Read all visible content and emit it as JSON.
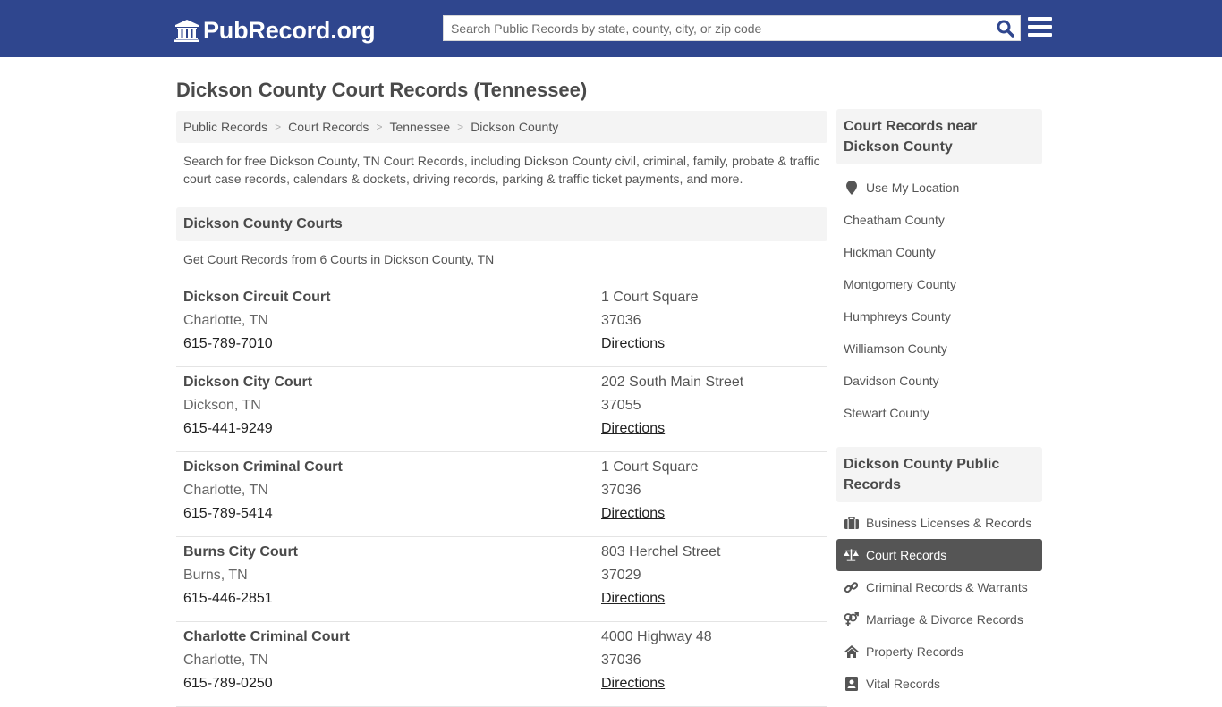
{
  "header": {
    "logo_text": "PubRecord.org",
    "logo_icon": "bank-building-icon",
    "search": {
      "placeholder": "Search Public Records by state, county, city, or zip code",
      "value": "",
      "button_icon": "search-icon"
    },
    "menu_icon": "hamburger-menu-icon"
  },
  "page": {
    "title": "Dickson County Court Records (Tennessee)",
    "breadcrumb": [
      "Public Records",
      "Court Records",
      "Tennessee",
      "Dickson County"
    ],
    "breadcrumb_separator": ">",
    "intro": "Search for free Dickson County, TN Court Records, including Dickson County civil, criminal, family, probate & traffic court case records, calendars & dockets, driving records, parking & traffic ticket payments, and more."
  },
  "courts_section": {
    "heading": "Dickson County Courts",
    "subheading": "Get Court Records from 6 Courts in Dickson County, TN",
    "directions_label": "Directions",
    "courts": [
      {
        "name": "Dickson Circuit Court",
        "city": "Charlotte, TN",
        "phone": "615-789-7010",
        "address": "1 Court Square",
        "zip": "37036"
      },
      {
        "name": "Dickson City Court",
        "city": "Dickson, TN",
        "phone": "615-441-9249",
        "address": "202 South Main Street",
        "zip": "37055"
      },
      {
        "name": "Dickson Criminal Court",
        "city": "Charlotte, TN",
        "phone": "615-789-5414",
        "address": "1 Court Square",
        "zip": "37036"
      },
      {
        "name": "Burns City Court",
        "city": "Burns, TN",
        "phone": "615-446-2851",
        "address": "803 Herchel Street",
        "zip": "37029"
      },
      {
        "name": "Charlotte Criminal Court",
        "city": "Charlotte, TN",
        "phone": "615-789-0250",
        "address": "4000 Highway 48",
        "zip": "37036"
      }
    ]
  },
  "sidebar": {
    "nearby": {
      "heading": "Court Records near Dickson County",
      "use_location": {
        "label": "Use My Location",
        "icon": "map-marker-icon"
      },
      "counties": [
        "Cheatham County",
        "Hickman County",
        "Montgomery County",
        "Humphreys County",
        "Williamson County",
        "Davidson County",
        "Stewart County"
      ]
    },
    "public_records": {
      "heading": "Dickson County Public Records",
      "items": [
        {
          "label": "Business Licenses & Records",
          "icon": "briefcase-icon",
          "active": false
        },
        {
          "label": "Court Records",
          "icon": "balance-scale-icon",
          "active": true
        },
        {
          "label": "Criminal Records & Warrants",
          "icon": "link-icon",
          "active": false
        },
        {
          "label": "Marriage & Divorce Records",
          "icon": "venus-mars-icon",
          "active": false
        },
        {
          "label": "Property Records",
          "icon": "home-icon",
          "active": false
        },
        {
          "label": "Vital Records",
          "icon": "id-card-icon",
          "active": false
        }
      ]
    }
  },
  "colors": {
    "header_bg": "#2f468e",
    "search_icon": "#2f468e",
    "active_item_bg": "#555555",
    "heading_box_bg": "#f4f4f4"
  }
}
